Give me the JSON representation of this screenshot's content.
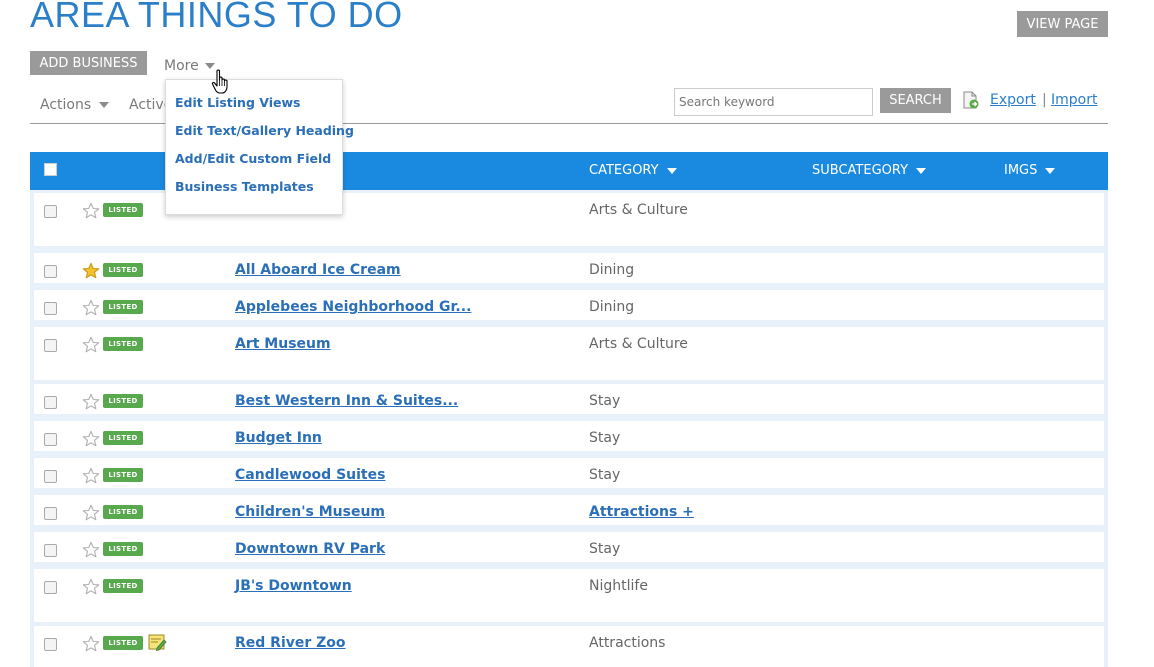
{
  "page": {
    "title": "AREA THINGS TO DO"
  },
  "header": {
    "view_page_label": "VIEW PAGE",
    "add_business_label": "ADD BUSINESS",
    "more_label": "More"
  },
  "more_menu": {
    "items": [
      {
        "label": "Edit Listing Views"
      },
      {
        "label": "Edit Text/Gallery Heading"
      },
      {
        "label": "Add/Edit Custom Field"
      },
      {
        "label": "Business Templates"
      }
    ]
  },
  "toolbar": {
    "actions_label": "Actions",
    "active_label": "Active",
    "search_placeholder": "Search keyword",
    "search_label": "SEARCH",
    "export_label": "Export",
    "separator": "|",
    "import_label": "Import"
  },
  "table": {
    "headers": {
      "category": "CATEGORY",
      "subcategory": "SUBCATEGORY",
      "imgs": "IMGS"
    },
    "badge_label": "LISTED",
    "rows": [
      {
        "name": "",
        "category": "Arts & Culture",
        "starred": false
      },
      {
        "name": "All Aboard Ice Cream",
        "category": "Dining",
        "starred": true
      },
      {
        "name": "Applebees Neighborhood Gr...",
        "category": "Dining",
        "starred": false
      },
      {
        "name": "Art Museum",
        "category": "Arts & Culture",
        "starred": false
      },
      {
        "name": "Best Western Inn & Suites...",
        "category": "Stay",
        "starred": false
      },
      {
        "name": "Budget Inn",
        "category": "Stay",
        "starred": false
      },
      {
        "name": "Candlewood Suites",
        "category": "Stay",
        "starred": false
      },
      {
        "name": "Children's Museum",
        "category": "Attractions +",
        "starred": false,
        "category_is_link": true
      },
      {
        "name": "Downtown RV Park",
        "category": "Stay",
        "starred": false
      },
      {
        "name": "JB's Downtown",
        "category": "Nightlife",
        "starred": false
      },
      {
        "name": "Red River Zoo",
        "category": "Attractions",
        "starred": false,
        "has_note_icon": true
      }
    ]
  },
  "colors": {
    "accent": "#1a8ae0",
    "link": "#2a6fb8",
    "title": "#2a7fc8",
    "badge": "#58a84e",
    "button": "#9a9a9a",
    "star_active": "#f2c12e"
  },
  "icons": {
    "star": "star-icon",
    "export": "export-icon",
    "caret": "caret-down-icon",
    "cursor": "hand-pointer-icon",
    "note": "note-edit-icon"
  }
}
